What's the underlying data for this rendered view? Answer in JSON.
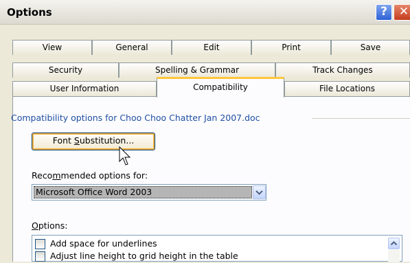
{
  "window": {
    "title": "Options",
    "help_glyph": "?",
    "close_glyph": "✕"
  },
  "tabs": {
    "row1": [
      "View",
      "General",
      "Edit",
      "Print",
      "Save"
    ],
    "row2": [
      "Security",
      "Spelling & Grammar",
      "Track Changes"
    ],
    "row3": [
      "User Information",
      "Compatibility",
      "File Locations"
    ],
    "active": "Compatibility"
  },
  "compat": {
    "group_title": "Compatibility options for Choo Choo Chatter Jan 2007.doc",
    "font_sub_pre": "Font ",
    "font_sub_key": "S",
    "font_sub_post": "ubstitution...",
    "recommended_pre": "Reco",
    "recommended_key": "m",
    "recommended_post": "mended options for:",
    "recommended_value": "Microsoft Office Word 2003",
    "options_key": "O",
    "options_post": "ptions:",
    "options_list": [
      {
        "label": "Add space for underlines",
        "checked": false
      },
      {
        "label": "Adjust line height to grid height in the table",
        "checked": false
      }
    ]
  },
  "colors": {
    "dialog_bg": "#ece9d8",
    "group_title": "#1f4ea3",
    "active_tab_accent": "#ffc73c",
    "selection_bg": "#b5b5b5"
  },
  "icons": [
    "help-icon",
    "close-icon",
    "chevron-down-icon",
    "scroll-up-icon",
    "mouse-pointer-icon"
  ]
}
